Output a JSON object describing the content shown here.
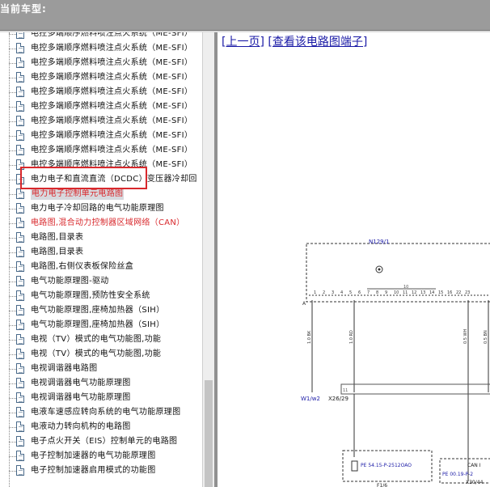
{
  "header": {
    "title": "当前车型:"
  },
  "tree": {
    "items": [
      {
        "label": "电控多端顺序燃料喷注点火系统（ME-SFI）",
        "style": "normal"
      },
      {
        "label": "电控多端顺序燃料喷注点火系统（ME-SFI）",
        "style": "normal"
      },
      {
        "label": "电控多端顺序燃料喷注点火系统（ME-SFI）",
        "style": "normal"
      },
      {
        "label": "电控多端顺序燃料喷注点火系统（ME-SFI）",
        "style": "normal"
      },
      {
        "label": "电控多端顺序燃料喷注点火系统（ME-SFI）",
        "style": "normal"
      },
      {
        "label": "电控多端顺序燃料喷注点火系统（ME-SFI）",
        "style": "normal"
      },
      {
        "label": "电控多端顺序燃料喷注点火系统（ME-SFI）",
        "style": "normal"
      },
      {
        "label": "电控多端顺序燃料喷注点火系统（ME-SFI）",
        "style": "normal"
      },
      {
        "label": "电控多端顺序燃料喷注点火系统（ME-SFI）",
        "style": "normal"
      },
      {
        "label": "电控多端顺序燃料喷注点火系统（ME-SFI）",
        "style": "normal"
      },
      {
        "label": "电力电子和直流直流（DCDC）变压器冷却回",
        "style": "normal"
      },
      {
        "label": "电力电子控制单元电路图",
        "style": "selected"
      },
      {
        "label": "电力电子冷却回路的电气功能原理图",
        "style": "normal"
      },
      {
        "label": "电路图,混合动力控制器区域网络（CAN）",
        "style": "red"
      },
      {
        "label": "电路图,目录表",
        "style": "normal"
      },
      {
        "label": "电路图,目录表",
        "style": "normal"
      },
      {
        "label": "电路图,右侧仪表板保险丝盒",
        "style": "normal"
      },
      {
        "label": "电气功能原理图-驱动",
        "style": "normal"
      },
      {
        "label": "电气功能原理图,预防性安全系统",
        "style": "normal"
      },
      {
        "label": "电气功能原理图,座椅加热器（SIH）",
        "style": "normal"
      },
      {
        "label": "电气功能原理图,座椅加热器（SIH）",
        "style": "normal"
      },
      {
        "label": "电视（TV）模式的电气功能图,功能",
        "style": "normal"
      },
      {
        "label": "电视（TV）模式的电气功能图,功能",
        "style": "normal"
      },
      {
        "label": "电视调谐器电路图",
        "style": "normal"
      },
      {
        "label": "电视调谐器电气功能原理图",
        "style": "normal"
      },
      {
        "label": "电视调谐器电气功能原理图",
        "style": "normal"
      },
      {
        "label": "电液车速感应转向系统的电气功能原理图",
        "style": "normal"
      },
      {
        "label": "电液动力转向机构的电路图",
        "style": "normal"
      },
      {
        "label": "电子点火开关（EIS）控制单元的电路图",
        "style": "normal"
      },
      {
        "label": "电子控制加速器的电气功能原理图",
        "style": "normal"
      },
      {
        "label": "电子控制加速器启用模式的功能图",
        "style": "normal"
      }
    ]
  },
  "content": {
    "prev_link": "[上一页]",
    "terminal_link": "[查看该电路图端子]"
  },
  "diagram": {
    "component_top": "N129/1",
    "conn_w1": "W1/w2",
    "conn_x26": "X26/29",
    "fuse_ref": "PE 54.15-P-2512OAO",
    "fuse_id": "F1/6",
    "can_ref": "PE 00.19-P-2",
    "can_label": "CAN I",
    "can_id": "X30/44",
    "wire_labels": [
      "1.0 BK",
      "1.0 RD",
      "0.5 WH",
      "0.5 BN"
    ],
    "pin_numbers": [
      "1",
      "2",
      "3",
      "4",
      "5",
      "6",
      "7",
      "8",
      "9",
      "10",
      "11",
      "12",
      "13",
      "14",
      "15",
      "16",
      "22",
      "23"
    ],
    "bus_letter": "A",
    "bus_numbers": [
      "10",
      "11"
    ]
  }
}
